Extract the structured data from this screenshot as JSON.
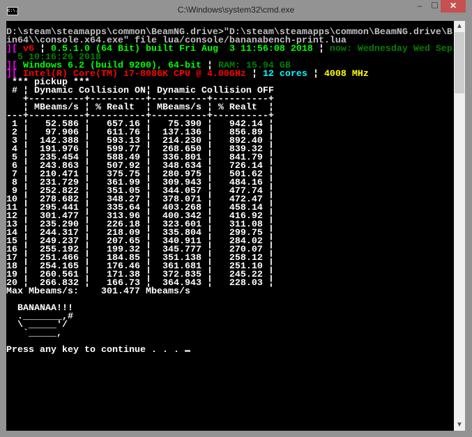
{
  "window": {
    "title": "C:\\Windows\\system32\\cmd.exe",
    "icon_label": "C:\\.",
    "min": "–",
    "max": "☐",
    "close": "✕"
  },
  "colors": {
    "accent_close": "#c75050",
    "magenta": "#ff00ff",
    "red": "#ff0000",
    "green": "#00ff00",
    "dark_green": "#008000",
    "cyan": "#00ffff",
    "yellow": "#ffff00"
  },
  "console": {
    "cmd_line1": "D:\\steam\\steamapps\\common\\BeamNG.drive>\"D:\\steam\\steamapps\\common\\BeamNG.drive\\B",
    "cmd_line2": "in64\\\\console.x64.exe\" file lua/console/bananabench-print.lua",
    "info1": {
      "prefix": "][",
      "ver": "v6",
      "sep": "¦",
      "build": "0.5.1.0 (64 Bit) built Fri Aug  3 11:56:08 2018",
      "now": "now: Wednesday Wed Sep",
      "now_cont": "  5 10:16:26 2018"
    },
    "info2": {
      "prefix": "][",
      "os": "Windows 6.2 (build 9200), 64-bit",
      "sep": "¦",
      "ram": "RAM: 15.94 GB"
    },
    "info3": {
      "prefix": "][",
      "cpu": "Intel(R) Core(TM) i7-8086K CPU @ 4.00GHz",
      "sep": "¦",
      "cores": "12 cores",
      "mhz": "4008 MHz"
    },
    "section": " *** pickup ***",
    "table": {
      "num_header": "#",
      "group_on": "Dynamic Collision ON",
      "group_off": "Dynamic Collision OFF",
      "col_mbeams": "MBeams/s",
      "col_realt": "% Realt",
      "rows": [
        [
          "1",
          "52.586",
          "657.16",
          "75.390",
          "942.14"
        ],
        [
          "2",
          "97.906",
          "611.76",
          "137.136",
          "856.89"
        ],
        [
          "3",
          "142.388",
          "593.13",
          "214.230",
          "892.40"
        ],
        [
          "4",
          "191.976",
          "599.77",
          "268.650",
          "839.32"
        ],
        [
          "5",
          "235.454",
          "588.49",
          "336.801",
          "841.79"
        ],
        [
          "6",
          "243.863",
          "507.92",
          "348.634",
          "726.14"
        ],
        [
          "7",
          "210.471",
          "375.75",
          "280.975",
          "501.62"
        ],
        [
          "8",
          "231.729",
          "361.99",
          "309.943",
          "484.16"
        ],
        [
          "9",
          "252.822",
          "351.05",
          "344.057",
          "477.74"
        ],
        [
          "10",
          "278.682",
          "348.27",
          "378.071",
          "472.47"
        ],
        [
          "11",
          "295.441",
          "335.64",
          "403.268",
          "458.14"
        ],
        [
          "12",
          "301.477",
          "313.96",
          "400.342",
          "416.92"
        ],
        [
          "13",
          "235.290",
          "226.18",
          "323.601",
          "311.08"
        ],
        [
          "14",
          "244.317",
          "218.09",
          "335.804",
          "299.75"
        ],
        [
          "15",
          "249.237",
          "207.65",
          "340.911",
          "284.02"
        ],
        [
          "16",
          "255.192",
          "199.32",
          "345.777",
          "270.07"
        ],
        [
          "17",
          "251.466",
          "184.85",
          "351.138",
          "258.12"
        ],
        [
          "18",
          "254.165",
          "176.46",
          "361.681",
          "251.10"
        ],
        [
          "19",
          "260.561",
          "171.38",
          "372.835",
          "245.22"
        ],
        [
          "20",
          "266.832",
          "166.73",
          "364.943",
          "228.03"
        ]
      ]
    },
    "max_line": "Max Mbeams/s:    301.477 Mbeams/s",
    "banana": [
      "  BANANAA!!!",
      "  ._______,#",
      "  \\ _____'/",
      "   `_____,"
    ],
    "prompt": "Press any key to continue . . . "
  }
}
